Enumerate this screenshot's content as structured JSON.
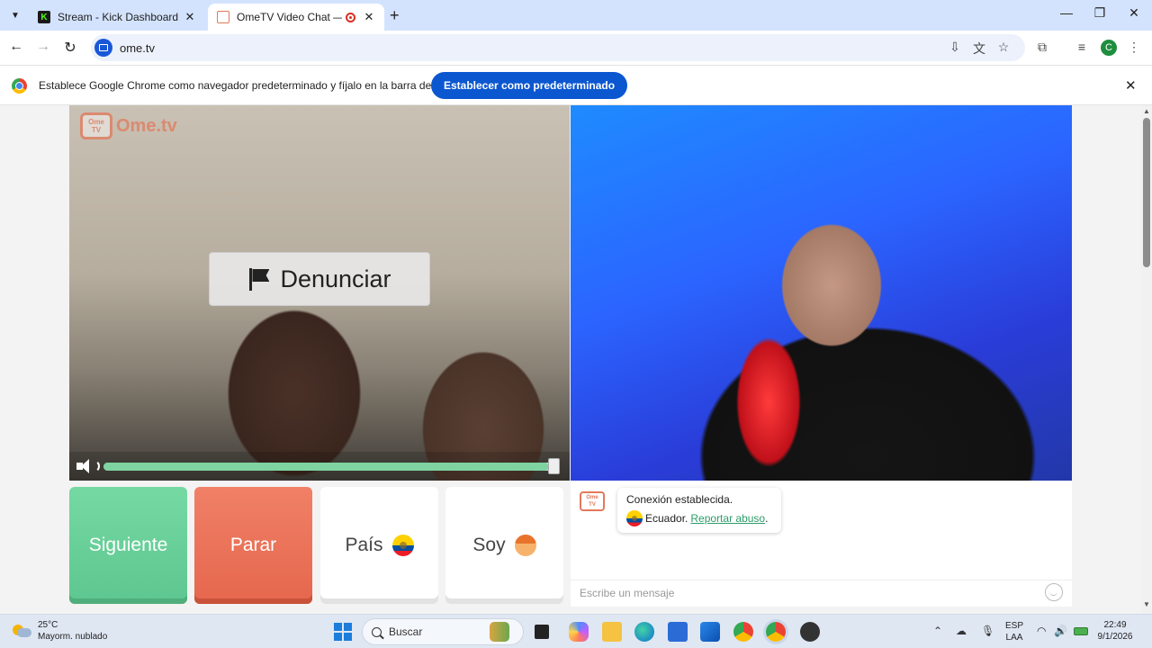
{
  "browser": {
    "tabs": [
      {
        "title": "Stream - Kick Dashboard",
        "active": false
      },
      {
        "title": "OmeTV Video Chat — Ome",
        "active": true
      }
    ],
    "url": "ome.tv",
    "profile_initial": "C",
    "infobar": {
      "text": "Establece Google Chrome como navegador predeterminado y fíjalo en la barra de tareas",
      "button": "Establecer como predeterminado"
    }
  },
  "app": {
    "logo": "Ome.tv",
    "logo_badge_top": "Ome",
    "logo_badge_bottom": "TV",
    "report_button": "Denunciar",
    "volume_level": 0.99,
    "controls": {
      "next": "Siguiente",
      "stop": "Parar",
      "country": "País",
      "gender": "Soy"
    },
    "chat": {
      "status": "Conexión establecida.",
      "country": "Ecuador.",
      "report_link": "Reportar abuso",
      "input_placeholder": "Escribe un mensaje"
    }
  },
  "taskbar": {
    "temperature": "25°C",
    "weather": "Mayorm. nublado",
    "search": "Buscar",
    "lang_top": "ESP",
    "lang_bottom": "LAA",
    "time": "22:49",
    "date": "9/1/2026"
  },
  "colors": {
    "next": "#6ccf9b",
    "stop": "#ec7358",
    "link": "#2e9d6a",
    "chrome_primary": "#0b57d0"
  }
}
